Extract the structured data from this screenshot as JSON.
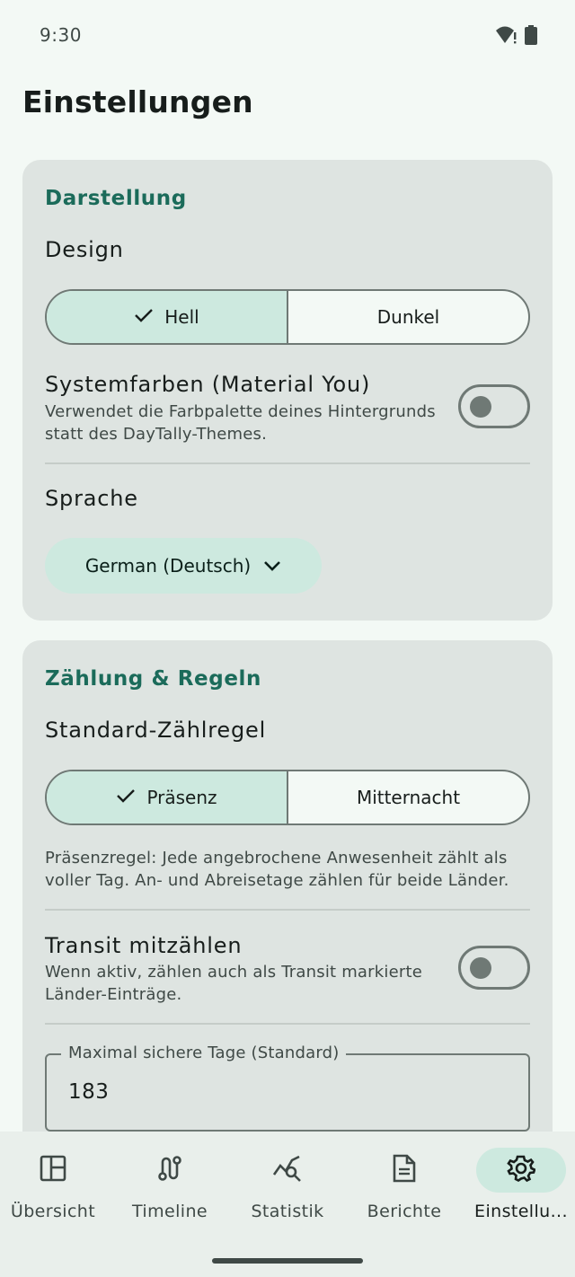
{
  "status_bar": {
    "time": "9:30",
    "icons": [
      "wifi-alert-icon",
      "battery-icon"
    ]
  },
  "page": {
    "title": "Einstellungen"
  },
  "appearance": {
    "section_title": "Darstellung",
    "design_label": "Design",
    "design_options": [
      {
        "label": "Hell",
        "selected": true
      },
      {
        "label": "Dunkel",
        "selected": false
      }
    ],
    "system_colors": {
      "title": "Systemfarben (Material You)",
      "subtitle": "Verwendet die Farbpalette deines Hintergrunds statt des DayTally-Themes.",
      "enabled": false
    },
    "language_label": "Sprache",
    "language_value": "German (Deutsch)"
  },
  "counting": {
    "section_title": "Zählung & Regeln",
    "rule_label": "Standard-Zählregel",
    "rule_options": [
      {
        "label": "Präsenz",
        "selected": true
      },
      {
        "label": "Mitternacht",
        "selected": false
      }
    ],
    "rule_helper": "Präsenzregel: Jede angebrochene Anwesenheit zählt als voller Tag. An- und Abreisetage zählen für beide Länder.",
    "transit": {
      "title": "Transit mitzählen",
      "subtitle": "Wenn aktiv, zählen auch als Transit markierte Länder-Einträge.",
      "enabled": false
    },
    "max_days": {
      "label": "Maximal sichere Tage (Standard)",
      "value": "183"
    }
  },
  "nav": {
    "items": [
      {
        "label": "Übersicht",
        "icon": "dashboard-icon",
        "active": false
      },
      {
        "label": "Timeline",
        "icon": "route-icon",
        "active": false
      },
      {
        "label": "Statistik",
        "icon": "query-stats-icon",
        "active": false
      },
      {
        "label": "Berichte",
        "icon": "document-icon",
        "active": false
      },
      {
        "label": "Einstellu...",
        "icon": "settings-icon",
        "active": true
      }
    ]
  },
  "colors": {
    "background": "#f3f9f5",
    "card": "#dee4e1",
    "accent": "#1b6b5a",
    "selected_container": "#cde9df",
    "outline": "#6f7975"
  }
}
